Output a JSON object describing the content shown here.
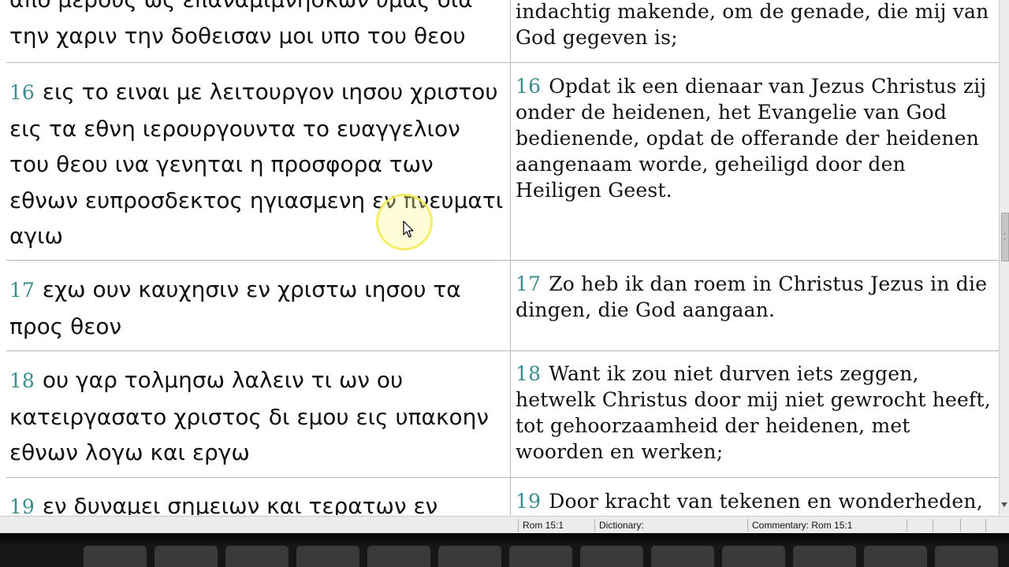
{
  "rows": [
    {
      "greek_num": "",
      "greek": "απο μερους ως επαναμιμνησκων υμας δια την χαριν την δοθεισαν μοι υπο του θεου",
      "dutch_num": "",
      "dutch": "indachtig makende, om de genade, die mij van God gegeven is;"
    },
    {
      "greek_num": "16",
      "greek": "εις το ειναι με λειτουργον ιησου χριστου εις τα εθνη ιερουργουντα το ευαγγελιον του θεου ινα γενηται η προσφορα των εθνων ευπροσδεκτος ηγιασμενη εν πνευματι αγιω",
      "dutch_num": "16",
      "dutch": "Opdat ik een dienaar van Jezus Christus zij onder de heidenen, het Evangelie van God bedienende, opdat de offerande der heidenen aangenaam worde, geheiligd door den Heiligen Geest."
    },
    {
      "greek_num": "17",
      "greek": "εχω ουν καυχησιν εν χριστω ιησου τα προς θεον",
      "dutch_num": "17",
      "dutch": "Zo heb ik dan roem in Christus Jezus in die dingen, die God aangaan."
    },
    {
      "greek_num": "18",
      "greek": "ου γαρ τολμησω λαλειν τι ων ου κατειργασατο χριστος δι εμου εις υπακοην εθνων λογω και εργω",
      "dutch_num": "18",
      "dutch": "Want ik zou niet durven iets zeggen, hetwelk Christus door mij niet gewrocht heeft, tot gehoorzaamheid der heidenen, met woorden en werken;"
    },
    {
      "greek_num": "19",
      "greek": "εν δυναμει σημειων και τερατων εν",
      "dutch_num": "19",
      "dutch": "Door kracht van tekenen en wonderheden,"
    }
  ],
  "statusbar": {
    "reference": "Rom 15:1",
    "dictionary": "Dictionary:",
    "commentary": "Commentary: Rom 15:1"
  },
  "cursor": {
    "icon": "arrow-cursor-icon",
    "highlight": "cursor-highlight-circle"
  }
}
